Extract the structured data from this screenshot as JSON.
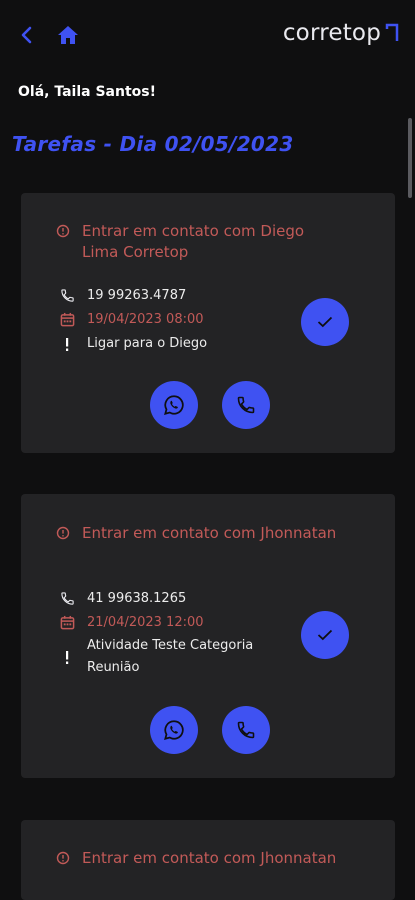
{
  "header": {
    "back_icon": "chevron-left-icon",
    "home_icon": "home-icon",
    "logo_text": "corretop",
    "logo_icon": "corner-arrow-icon"
  },
  "greeting": "Olá, Taila Santos!",
  "section_title": "Tarefas - Dia 02/05/2023",
  "colors": {
    "accent": "#3f52f2",
    "alert": "#c25a58",
    "card": "#232325",
    "background": "#0f0f10"
  },
  "tasks": [
    {
      "title": "Entrar em contato com Diego Lima Corretop",
      "phone": "19 99263.4787",
      "datetime": "19/04/2023 08:00",
      "note": "Ligar para o Diego"
    },
    {
      "title": "Entrar em contato com Jhonnatan",
      "phone": "41 99638.1265",
      "datetime": "21/04/2023 12:00",
      "note": "Atividade Teste Categoria Reunião"
    },
    {
      "title": "Entrar em contato com Jhonnatan"
    }
  ]
}
